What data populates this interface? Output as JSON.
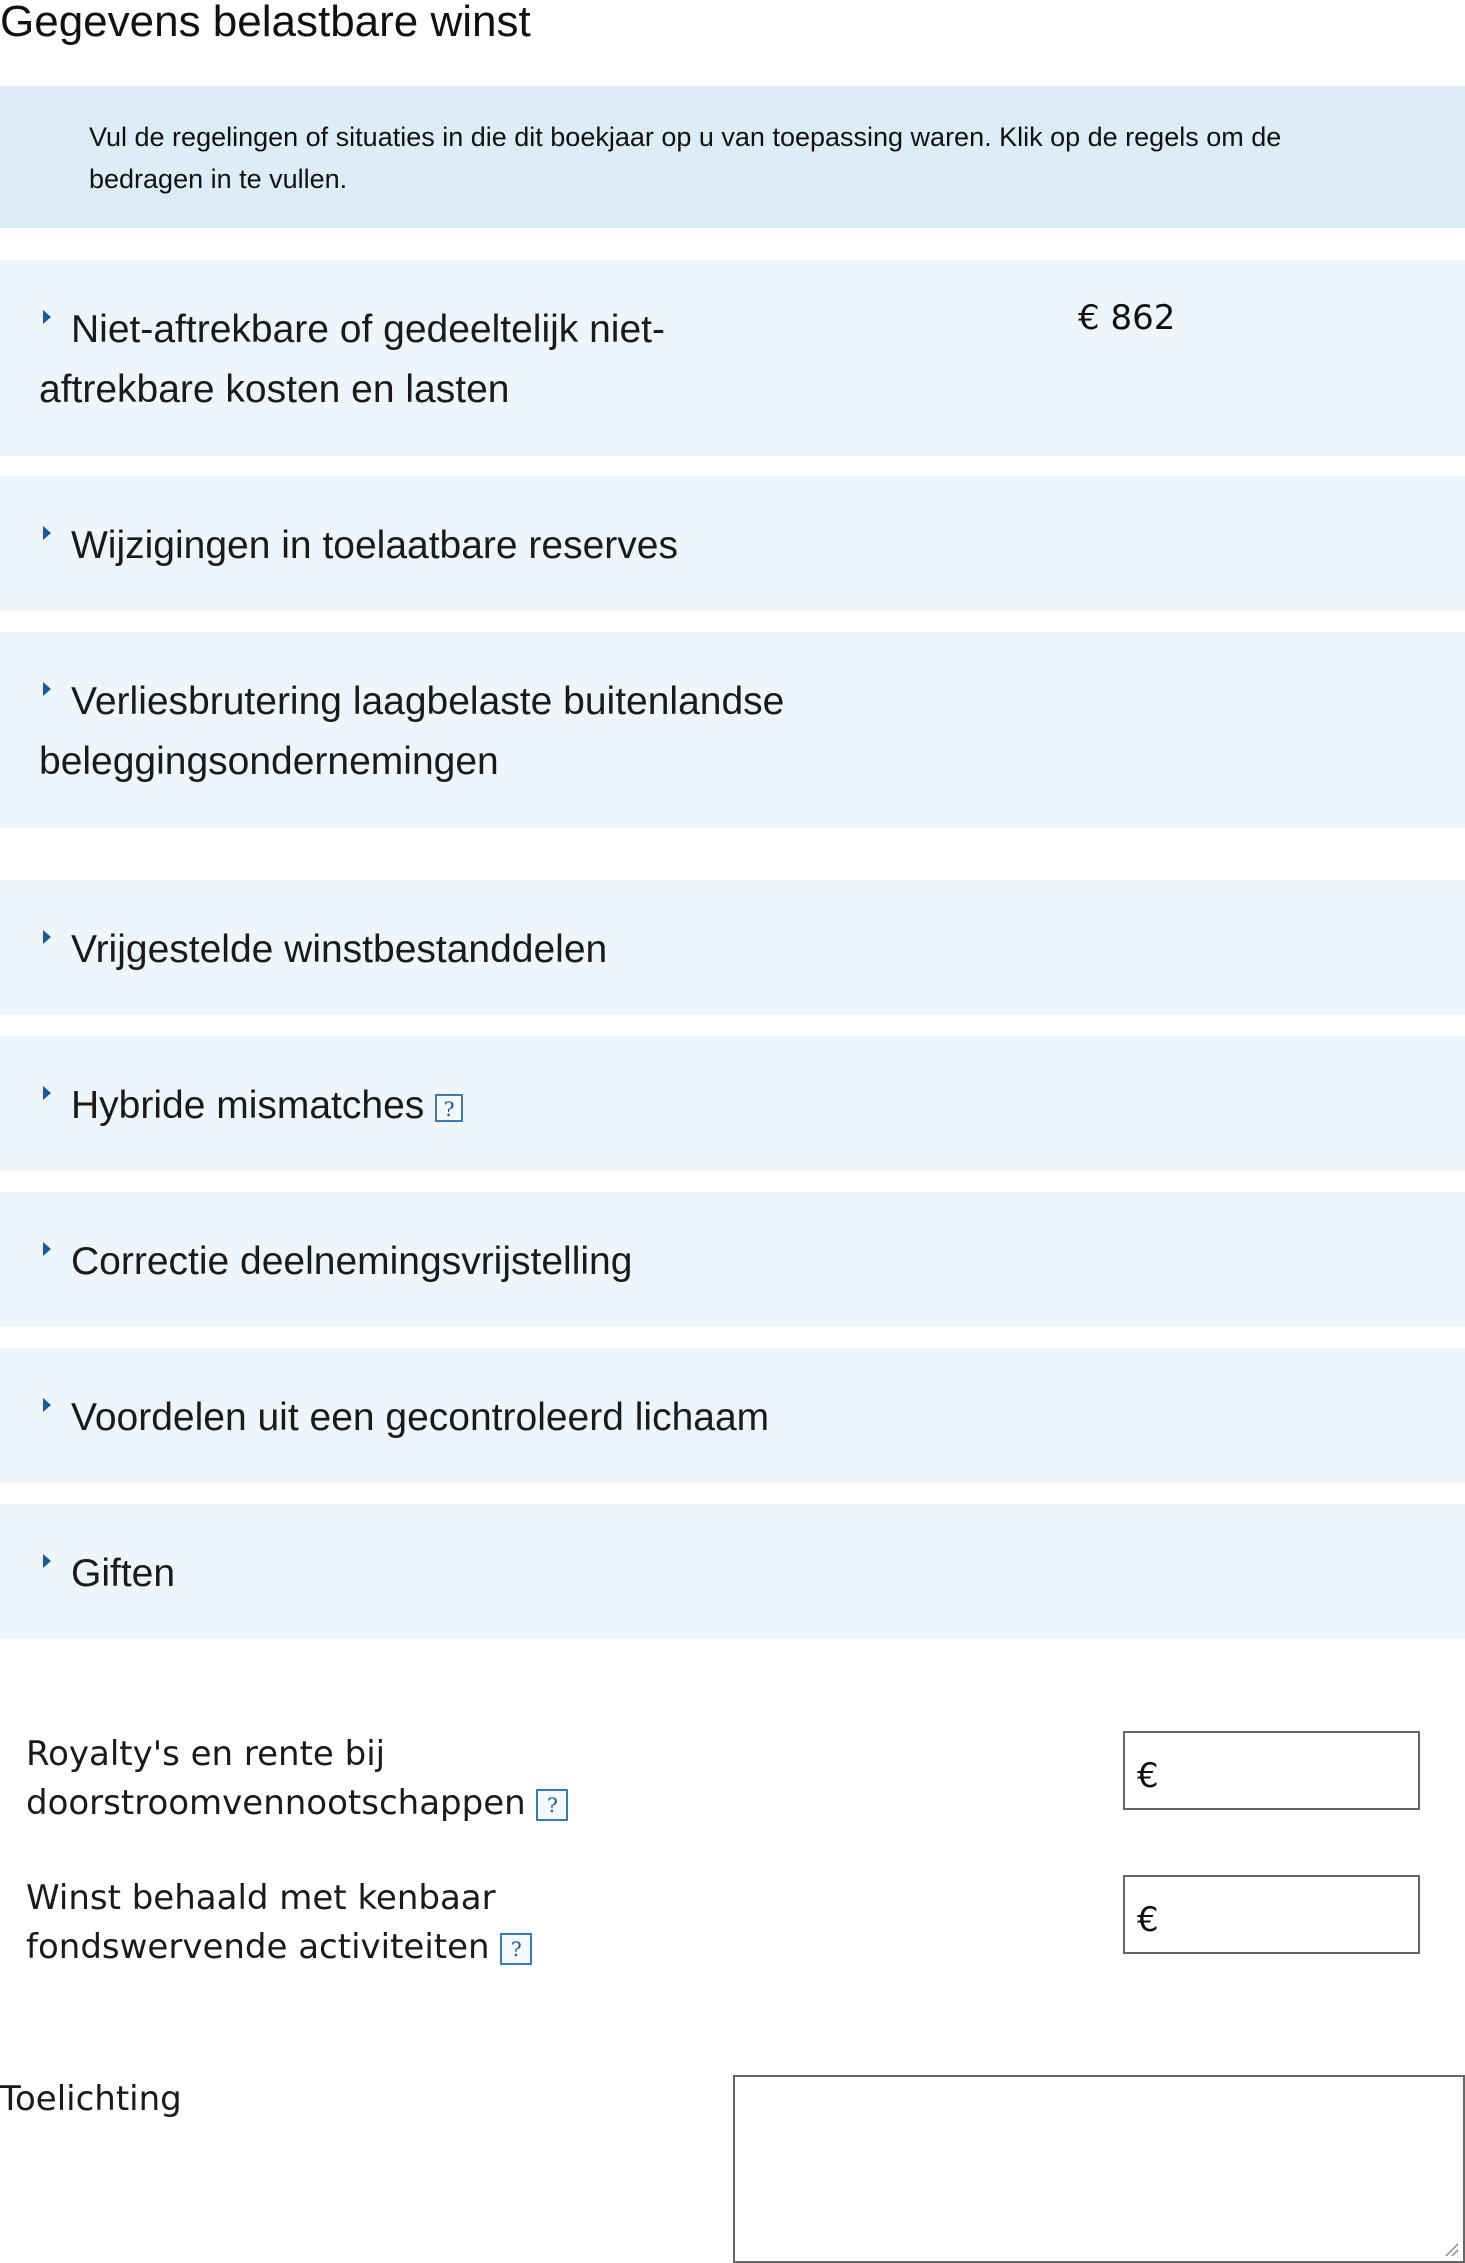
{
  "page_title": "Gegevens belastbare winst",
  "intro_text": "Vul de regelingen of situaties in die dit boekjaar op u van toepassing waren. Klik op de regels om de bedragen in te vullen.",
  "sections": [
    {
      "label": "Niet-aftrekbare of gedeeltelijk niet-aftrekbare kosten en lasten",
      "amount": "€ 862"
    },
    {
      "label": "Wijzigingen in toelaatbare reserves"
    },
    {
      "label": "Verliesbrutering laagbelaste buitenlandse beleggingsondernemingen"
    },
    {
      "label": "Vrijgestelde winstbestanddelen"
    },
    {
      "label": "Hybride mismatches",
      "help": "?"
    },
    {
      "label": "Correctie deelnemingsvrijstelling"
    },
    {
      "label": "Voordelen uit een gecontroleerd lichaam"
    },
    {
      "label": "Giften"
    }
  ],
  "fields": {
    "royalty": {
      "label": "Royalty's en rente bij doorstroomvennootschappen",
      "help": "?",
      "currency": "€",
      "value": ""
    },
    "fondswerving": {
      "label": "Winst behaald met kenbaar fondswervende activiteiten",
      "help": "?",
      "currency": "€",
      "value": ""
    }
  },
  "toelichting": {
    "label": "Toelichting",
    "value": ""
  },
  "colors": {
    "intro_bg": "#dcedf8",
    "section_bg": "#eef6fc",
    "caret": "#1a5a9a"
  }
}
